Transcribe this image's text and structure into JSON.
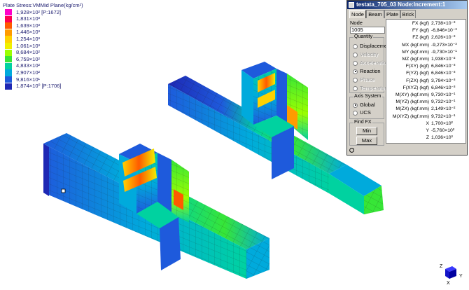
{
  "legend": {
    "title": "Plate Stress:VMMid Plane(kg/cm²)",
    "items": [
      {
        "label": "1,928×10² [P:1672]",
        "color": "#ff00c8"
      },
      {
        "label": "1,831×10³",
        "color": "#ff0050"
      },
      {
        "label": "1,639×10³",
        "color": "#ff5a00"
      },
      {
        "label": "1,446×10³",
        "color": "#ff9b00"
      },
      {
        "label": "1,254×10³",
        "color": "#ffd200"
      },
      {
        "label": "1,061×10³",
        "color": "#f0f000"
      },
      {
        "label": "8,684×10²",
        "color": "#9bff00"
      },
      {
        "label": "6,759×10²",
        "color": "#37e637"
      },
      {
        "label": "4,833×10²",
        "color": "#00d2a0"
      },
      {
        "label": "2,907×10²",
        "color": "#00aadc"
      },
      {
        "label": "9,816×10¹",
        "color": "#1e5adc"
      },
      {
        "label": "1,874×10⁰ [P:1706]",
        "color": "#1e28b4"
      }
    ]
  },
  "panel": {
    "title": "testata_705_03 Node:Increment:1",
    "tabs": [
      "Node",
      "Beam",
      "Plate",
      "Brick"
    ],
    "active_tab": "Node",
    "node_label": "Node",
    "node_value": "1005",
    "quantity": {
      "label": "Quantity",
      "options": [
        {
          "label": "Displacement",
          "enabled": true,
          "selected": false
        },
        {
          "label": "Velocity",
          "enabled": false,
          "selected": false
        },
        {
          "label": "Acceleration",
          "enabled": false,
          "selected": false
        },
        {
          "label": "Reaction",
          "enabled": true,
          "selected": true
        },
        {
          "label": "Phase",
          "enabled": false,
          "selected": false
        },
        {
          "label": "Temperature",
          "enabled": false,
          "selected": false
        }
      ]
    },
    "axis_system": {
      "label": "Axis System",
      "options": [
        {
          "label": "Global",
          "selected": true
        },
        {
          "label": "UCS",
          "selected": false
        }
      ]
    },
    "find": {
      "label": "Find FX",
      "min_label": "Min",
      "max_label": "Max"
    },
    "results": [
      {
        "label": "FX (kgf)",
        "value": "2,738×10⁻³"
      },
      {
        "label": "FY (kgf)",
        "value": "-6,846×10⁻³"
      },
      {
        "label": "FZ (kgf)",
        "value": "2,626×10⁻³"
      },
      {
        "label": "MX (kgf.mm)",
        "value": "-9,273×10⁻³"
      },
      {
        "label": "MY (kgf.mm)",
        "value": "-9,730×10⁻¹"
      },
      {
        "label": "MZ (kgf.mm)",
        "value": "1,938×10⁻²"
      },
      {
        "label": "F(XY) (kgf)",
        "value": "6,846×10⁻³"
      },
      {
        "label": "F(YZ) (kgf)",
        "value": "6,846×10⁻³"
      },
      {
        "label": "F(ZX) (kgf)",
        "value": "3,794×10⁻³"
      },
      {
        "label": "F(XYZ) (kgf)",
        "value": "6,846×10⁻³"
      },
      {
        "label": "M(XY) (kgf.mm)",
        "value": "9,730×10⁻¹"
      },
      {
        "label": "M(YZ) (kgf.mm)",
        "value": "9,732×10⁻¹"
      },
      {
        "label": "M(ZX) (kgf.mm)",
        "value": "2,149×10⁻²"
      },
      {
        "label": "M(XYZ) (kgf.mm)",
        "value": "9,732×10⁻¹"
      },
      {
        "label": "X",
        "value": "1,700×10²"
      },
      {
        "label": "Y",
        "value": "-5,760×10²"
      },
      {
        "label": "Z",
        "value": "1,036×10³"
      }
    ]
  },
  "axis_triad": {
    "x": "X",
    "y": "Y",
    "z": "Z"
  }
}
